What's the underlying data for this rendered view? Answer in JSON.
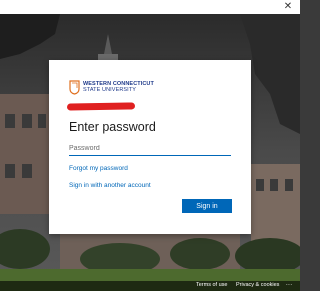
{
  "window": {
    "close_glyph": "✕"
  },
  "brand": {
    "name_line1": "WESTERN CONNECTICUT",
    "name_line2": "STATE UNIVERSITY",
    "colors": {
      "primary": "#1f3a8a",
      "accent": "#e07020"
    }
  },
  "signin": {
    "title": "Enter password",
    "password_placeholder": "Password",
    "password_value": "",
    "forgot_link": "Forgot my password",
    "other_account_link": "Sign in with another account",
    "submit_label": "Sign in"
  },
  "footer": {
    "terms": "Terms of use",
    "privacy": "Privacy & cookies",
    "more": "..."
  },
  "colors": {
    "accent": "#0067b8",
    "redaction": "#e02020"
  },
  "icons": [
    "close-icon",
    "university-logo-icon"
  ]
}
